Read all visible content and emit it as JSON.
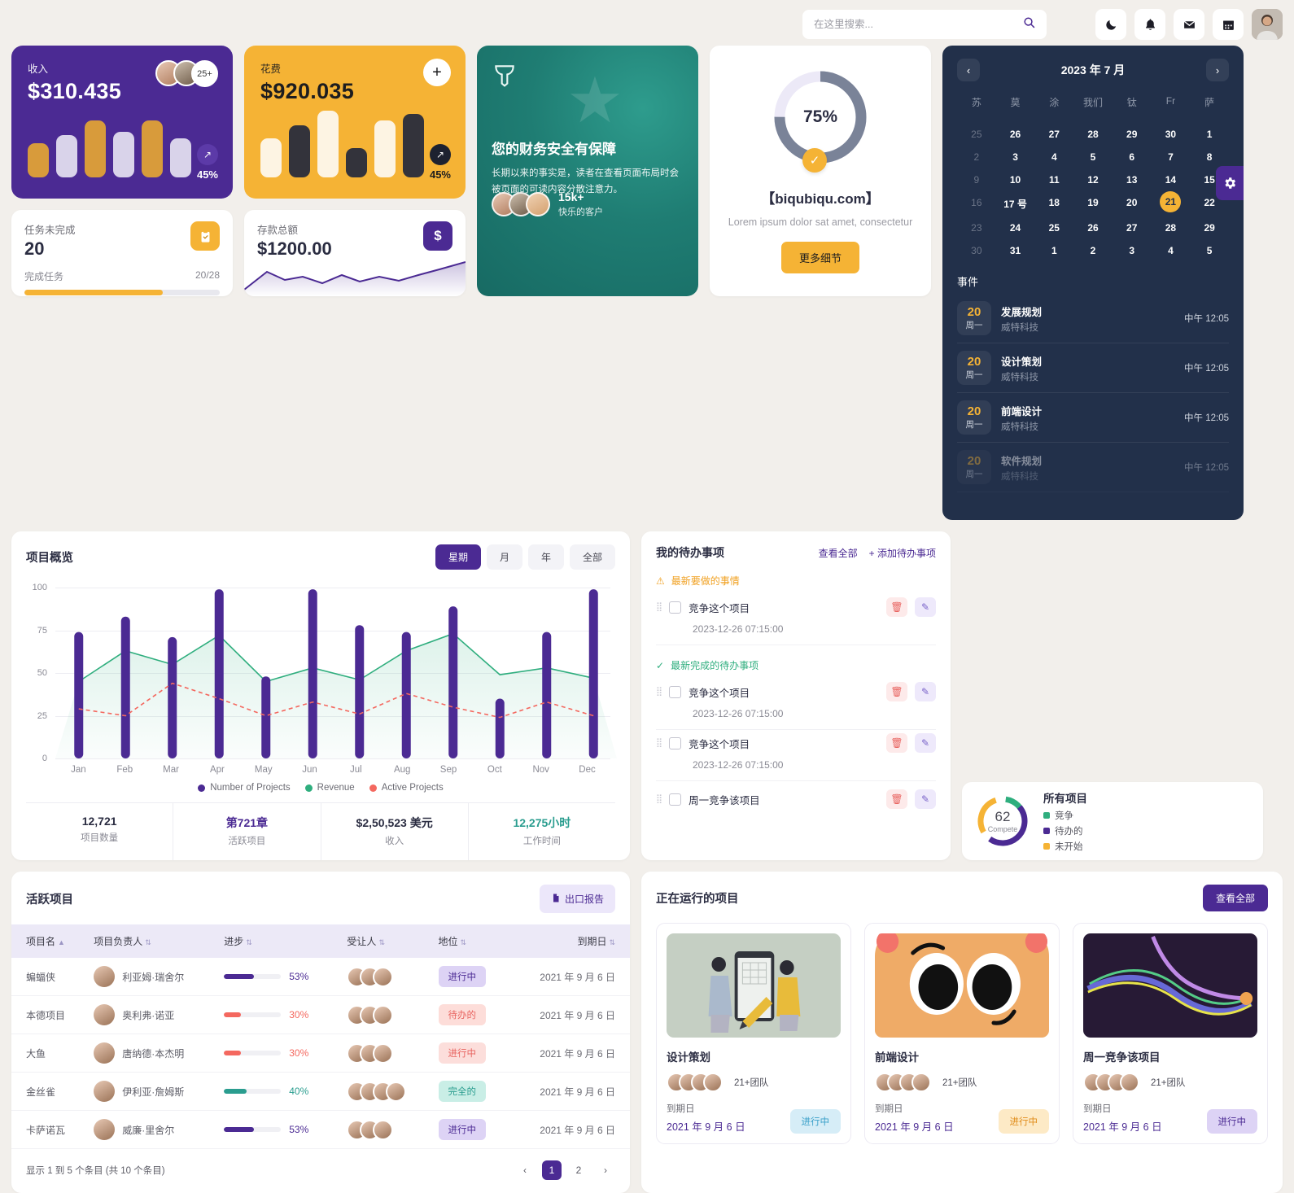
{
  "header": {
    "search_placeholder": "在这里搜索...",
    "search_value": "",
    "icons": [
      "moon-icon",
      "bell-icon",
      "mail-icon",
      "calendar-icon"
    ]
  },
  "colors": {
    "purple": "#4b2a93",
    "amber": "#f5b335",
    "teal": "#1f7d73",
    "green": "#2fae7e",
    "red": "#f4685f",
    "dark": "#22304a"
  },
  "income_card": {
    "label": "收入",
    "value": "$310.435",
    "avatar_more": "25+",
    "trend_pct": "45%",
    "trend_icon": "arrow-up-right-icon"
  },
  "expense_card": {
    "label": "花费",
    "value": "$920.035",
    "add_label": "+",
    "trend_pct": "45%",
    "trend_icon": "arrow-up-right-icon"
  },
  "tasks_card": {
    "label": "任务未完成",
    "value": "20",
    "sub_label": "完成任务",
    "ratio": "20/28",
    "progress_percent": 71,
    "icon": "clipboard-check-icon"
  },
  "deposit_card": {
    "label": "存款总额",
    "value": "$1200.00",
    "icon": "dollar-icon"
  },
  "promo_card": {
    "title": "您的财务安全有保障",
    "body": "长期以来的事实是，读者在查看页面布局时会被页面的可读内容分散注意力。",
    "customers_count": "15k+",
    "customers_label": "快乐的客户",
    "logo": "shield-icon"
  },
  "progress_card": {
    "percent_label": "75%",
    "percent": 75,
    "title": "【biqubiqu.com】",
    "subtitle": "Lorem ipsum dolor sat amet, consectetur",
    "button": "更多细节",
    "check_icon": "check-icon"
  },
  "calendar": {
    "title": "2023 年 7 月",
    "prev_icon": "chevron-left-icon",
    "next_icon": "chevron-right-icon",
    "dow": [
      "苏",
      "莫",
      "涂",
      "我们",
      "钛",
      "Fr",
      "萨"
    ],
    "weeks": [
      [
        {
          "d": "25",
          "muted": true
        },
        {
          "d": "26"
        },
        {
          "d": "27"
        },
        {
          "d": "28"
        },
        {
          "d": "29"
        },
        {
          "d": "30"
        },
        {
          "d": "1"
        }
      ],
      [
        {
          "d": "2",
          "muted": true
        },
        {
          "d": "3"
        },
        {
          "d": "4"
        },
        {
          "d": "5"
        },
        {
          "d": "6"
        },
        {
          "d": "7"
        },
        {
          "d": "8"
        }
      ],
      [
        {
          "d": "9",
          "muted": true
        },
        {
          "d": "10"
        },
        {
          "d": "11"
        },
        {
          "d": "12"
        },
        {
          "d": "13"
        },
        {
          "d": "14"
        },
        {
          "d": "15"
        }
      ],
      [
        {
          "d": "16",
          "muted": true
        },
        {
          "d": "17 号"
        },
        {
          "d": "18"
        },
        {
          "d": "19"
        },
        {
          "d": "20"
        },
        {
          "d": "21",
          "sel": true
        },
        {
          "d": "22"
        }
      ],
      [
        {
          "d": "23",
          "muted": true
        },
        {
          "d": "24"
        },
        {
          "d": "25"
        },
        {
          "d": "26"
        },
        {
          "d": "27"
        },
        {
          "d": "28"
        },
        {
          "d": "29"
        }
      ],
      [
        {
          "d": "30",
          "muted": true
        },
        {
          "d": "31"
        },
        {
          "d": "1"
        },
        {
          "d": "2"
        },
        {
          "d": "3"
        },
        {
          "d": "4"
        },
        {
          "d": "5"
        }
      ]
    ],
    "events_title": "事件",
    "events": [
      {
        "day": "20",
        "dow": "周一",
        "name": "发展规划",
        "org": "威特科技",
        "time": "中午 12:05"
      },
      {
        "day": "20",
        "dow": "周一",
        "name": "设计策划",
        "org": "威特科技",
        "time": "中午 12:05"
      },
      {
        "day": "20",
        "dow": "周一",
        "name": "前端设计",
        "org": "威特科技",
        "time": "中午 12:05"
      },
      {
        "day": "20",
        "dow": "周一",
        "name": "软件规划",
        "org": "威特科技",
        "time": "中午 12:05"
      }
    ],
    "settings_icon": "gear-icon"
  },
  "all_projects": {
    "number": "62",
    "number_sub": "Compete",
    "title": "所有项目",
    "legend": [
      {
        "label": "竞争",
        "color": "#2fae7e"
      },
      {
        "label": "待办的",
        "color": "#4b2a93"
      },
      {
        "label": "未开始",
        "color": "#f5b335"
      }
    ]
  },
  "chart_card": {
    "title": "项目概览",
    "tabs": [
      {
        "label": "星期",
        "active": true
      },
      {
        "label": "月",
        "active": false
      },
      {
        "label": "年",
        "active": false
      },
      {
        "label": "全部",
        "active": false
      }
    ],
    "kpis": [
      {
        "value": "12,721",
        "label": "项目数量",
        "color": "#2b2d42"
      },
      {
        "value": "第721章",
        "label": "活跃项目",
        "color": "#4b2a93"
      },
      {
        "value": "$2,50,523 美元",
        "label": "收入",
        "color": "#2b2d42"
      },
      {
        "value": "12,275小时",
        "label": "工作时间",
        "color": "#2a9d8f"
      }
    ]
  },
  "chart_data": {
    "type": "bar",
    "title": "项目概览",
    "xlabel": "",
    "ylabel": "",
    "ylim": [
      0,
      100
    ],
    "yticks": [
      0,
      25,
      50,
      75,
      100
    ],
    "grid": true,
    "legend_position": "bottom",
    "categories": [
      "Jan",
      "Feb",
      "Mar",
      "Apr",
      "May",
      "Jun",
      "Jul",
      "Aug",
      "Sep",
      "Oct",
      "Nov",
      "Dec"
    ],
    "series": [
      {
        "name": "Number of Projects",
        "type": "bar",
        "color": "#4b2a93",
        "values": [
          74,
          83,
          71,
          99,
          48,
          99,
          78,
          74,
          89,
          35,
          74,
          99
        ]
      },
      {
        "name": "Revenue",
        "type": "area",
        "color": "#2fae7e",
        "values": [
          45,
          63,
          55,
          72,
          45,
          53,
          46,
          63,
          73,
          49,
          53,
          47
        ]
      },
      {
        "name": "Active Projects",
        "type": "line",
        "color": "#f4685f",
        "dashed": true,
        "values": [
          29,
          25,
          44,
          35,
          25,
          33,
          26,
          38,
          30,
          24,
          33,
          25
        ]
      }
    ]
  },
  "todo": {
    "title": "我的待办事项",
    "view_all": "查看全部",
    "add": "+ 添加待办事项",
    "section_new": "最新要做的事情",
    "section_done": "最新完成的待办事项",
    "items": [
      {
        "text": "竞争这个项目",
        "date": "2023-12-26 07:15:00",
        "section": "new"
      },
      {
        "text": "竞争这个项目",
        "date": "2023-12-26 07:15:00",
        "section": "done"
      },
      {
        "text": "竞争这个项目",
        "date": "2023-12-26 07:15:00",
        "section": ""
      },
      {
        "text": "周一竞争该项目",
        "date": "",
        "section": ""
      }
    ],
    "delete_icon": "trash-icon",
    "edit_icon": "pencil-icon"
  },
  "table": {
    "title": "活跃项目",
    "export_label": "出口报告",
    "export_icon": "file-export-icon",
    "columns": [
      "项目名",
      "项目负责人",
      "进步",
      "受让人",
      "地位",
      "到期日"
    ],
    "rows": [
      {
        "name": "蝙蝠侠",
        "owner": "利亚姆·瑞舍尔",
        "progress": 53,
        "progress_label": "53%",
        "progress_color": "#4b2a93",
        "assignees": 3,
        "status": "进行中",
        "status_bg": "#ddd3f5",
        "status_fg": "#4b2a93",
        "due": "2021 年 9 月 6 日"
      },
      {
        "name": "本德项目",
        "owner": "奥利弗·诺亚",
        "progress": 30,
        "progress_label": "30%",
        "progress_color": "#f4685f",
        "assignees": 3,
        "status": "待办的",
        "status_bg": "#fdddd9",
        "status_fg": "#e8635f",
        "due": "2021 年 9 月 6 日"
      },
      {
        "name": "大鱼",
        "owner": "唐纳德·本杰明",
        "progress": 30,
        "progress_label": "30%",
        "progress_color": "#f4685f",
        "assignees": 3,
        "status": "进行中",
        "status_bg": "#fcdedb",
        "status_fg": "#e8635f",
        "due": "2021 年 9 月 6 日"
      },
      {
        "name": "金丝雀",
        "owner": "伊利亚·詹姆斯",
        "progress": 40,
        "progress_label": "40%",
        "progress_color": "#2a9d8f",
        "assignees": 4,
        "status": "完全的",
        "status_bg": "#c9eee6",
        "status_fg": "#2a9d8f",
        "due": "2021 年 9 月 6 日"
      },
      {
        "name": "卡萨诺瓦",
        "owner": "威廉·里舍尔",
        "progress": 53,
        "progress_label": "53%",
        "progress_color": "#4b2a93",
        "assignees": 3,
        "status": "进行中",
        "status_bg": "#ddd3f5",
        "status_fg": "#4b2a93",
        "due": "2021 年 9 月 6 日"
      }
    ],
    "footer_info": "显示 1 到 5 个条目 (共 10 个条目)",
    "pages": [
      "1",
      "2"
    ],
    "active_page": "1",
    "prev_icon": "chevron-left-icon",
    "next_icon": "chevron-right-icon"
  },
  "running": {
    "title": "正在运行的项目",
    "view_all": "查看全部",
    "cards": [
      {
        "name": "设计策划",
        "team": "21+团队",
        "due_label": "到期日",
        "due": "2021 年 9 月 6 日",
        "chip": "进行中",
        "chip_bg": "#d6edf7",
        "chip_fg": "#3aa0c9",
        "thumb": "design-illustration"
      },
      {
        "name": "前端设计",
        "team": "21+团队",
        "due_label": "到期日",
        "due": "2021 年 9 月 6 日",
        "chip": "进行中",
        "chip_bg": "#fdeac6",
        "chip_fg": "#e08c1a",
        "thumb": "face-illustration"
      },
      {
        "name": "周一竞争该项目",
        "team": "21+团队",
        "due_label": "到期日",
        "due": "2021 年 9 月 6 日",
        "chip": "进行中",
        "chip_bg": "#ddd3f5",
        "chip_fg": "#4b2a93",
        "thumb": "wave-chart"
      }
    ]
  }
}
